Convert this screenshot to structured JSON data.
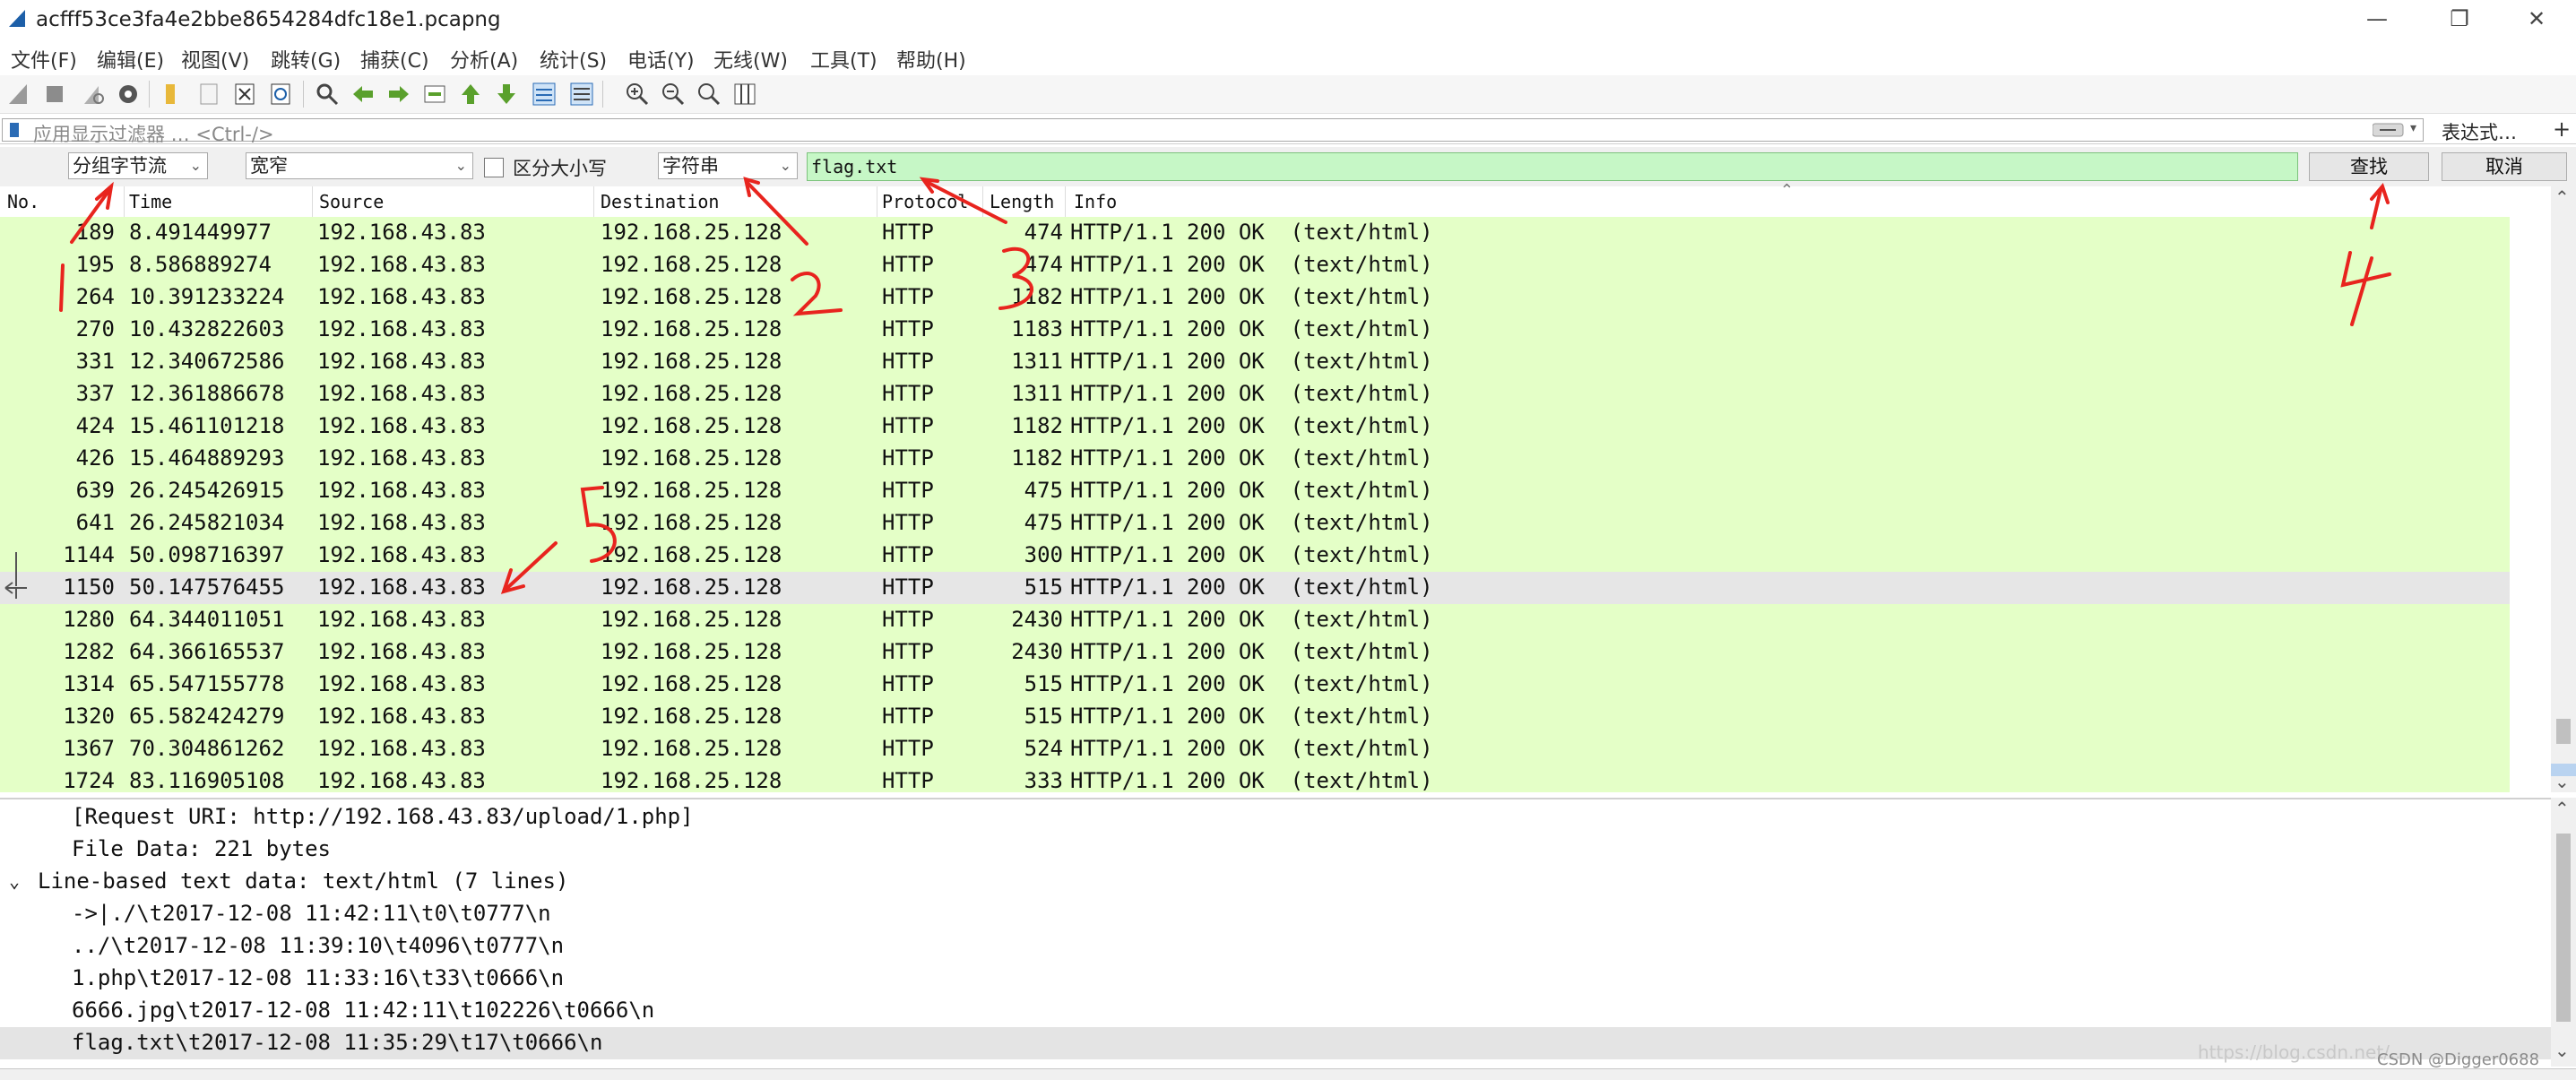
{
  "window": {
    "title": "acfff53ce3fa4e2bbe8654284dfc18e1.pcapng",
    "buttons": [
      "—",
      "❐",
      "✕"
    ]
  },
  "menu": [
    "文件(F)",
    "编辑(E)",
    "视图(V)",
    "跳转(G)",
    "捕获(C)",
    "分析(A)",
    "统计(S)",
    "电话(Y)",
    "无线(W)",
    "工具(T)",
    "帮助(H)"
  ],
  "filter": {
    "placeholder": "应用显示过滤器 … <Ctrl-/>",
    "expression_label": "表达式…",
    "plus": "+"
  },
  "find": {
    "search_in": "分组字节流",
    "char_width": "宽窄",
    "case_label": "区分大小写",
    "search_type": "字符串",
    "search_value": "flag.txt",
    "find_label": "查找",
    "cancel_label": "取消"
  },
  "columns": [
    "No.",
    "Time",
    "Source",
    "Destination",
    "Protocol",
    "Length",
    "Info"
  ],
  "packets": [
    {
      "no": "189",
      "time": "8.491449977",
      "src": "192.168.43.83",
      "dst": "192.168.25.128",
      "proto": "HTTP",
      "len": "474",
      "info": "HTTP/1.1 200 OK  (text/html)"
    },
    {
      "no": "195",
      "time": "8.586889274",
      "src": "192.168.43.83",
      "dst": "192.168.25.128",
      "proto": "HTTP",
      "len": "474",
      "info": "HTTP/1.1 200 OK  (text/html)"
    },
    {
      "no": "264",
      "time": "10.391233224",
      "src": "192.168.43.83",
      "dst": "192.168.25.128",
      "proto": "HTTP",
      "len": "1182",
      "info": "HTTP/1.1 200 OK  (text/html)"
    },
    {
      "no": "270",
      "time": "10.432822603",
      "src": "192.168.43.83",
      "dst": "192.168.25.128",
      "proto": "HTTP",
      "len": "1183",
      "info": "HTTP/1.1 200 OK  (text/html)"
    },
    {
      "no": "331",
      "time": "12.340672586",
      "src": "192.168.43.83",
      "dst": "192.168.25.128",
      "proto": "HTTP",
      "len": "1311",
      "info": "HTTP/1.1 200 OK  (text/html)"
    },
    {
      "no": "337",
      "time": "12.361886678",
      "src": "192.168.43.83",
      "dst": "192.168.25.128",
      "proto": "HTTP",
      "len": "1311",
      "info": "HTTP/1.1 200 OK  (text/html)"
    },
    {
      "no": "424",
      "time": "15.461101218",
      "src": "192.168.43.83",
      "dst": "192.168.25.128",
      "proto": "HTTP",
      "len": "1182",
      "info": "HTTP/1.1 200 OK  (text/html)"
    },
    {
      "no": "426",
      "time": "15.464889293",
      "src": "192.168.43.83",
      "dst": "192.168.25.128",
      "proto": "HTTP",
      "len": "1182",
      "info": "HTTP/1.1 200 OK  (text/html)"
    },
    {
      "no": "639",
      "time": "26.245426915",
      "src": "192.168.43.83",
      "dst": "192.168.25.128",
      "proto": "HTTP",
      "len": "475",
      "info": "HTTP/1.1 200 OK  (text/html)"
    },
    {
      "no": "641",
      "time": "26.245821034",
      "src": "192.168.43.83",
      "dst": "192.168.25.128",
      "proto": "HTTP",
      "len": "475",
      "info": "HTTP/1.1 200 OK  (text/html)"
    },
    {
      "no": "1144",
      "time": "50.098716397",
      "src": "192.168.43.83",
      "dst": "192.168.25.128",
      "proto": "HTTP",
      "len": "300",
      "info": "HTTP/1.1 200 OK  (text/html)"
    },
    {
      "no": "1150",
      "time": "50.147576455",
      "src": "192.168.43.83",
      "dst": "192.168.25.128",
      "proto": "HTTP",
      "len": "515",
      "info": "HTTP/1.1 200 OK  (text/html)"
    },
    {
      "no": "1280",
      "time": "64.344011051",
      "src": "192.168.43.83",
      "dst": "192.168.25.128",
      "proto": "HTTP",
      "len": "2430",
      "info": "HTTP/1.1 200 OK  (text/html)"
    },
    {
      "no": "1282",
      "time": "64.366165537",
      "src": "192.168.43.83",
      "dst": "192.168.25.128",
      "proto": "HTTP",
      "len": "2430",
      "info": "HTTP/1.1 200 OK  (text/html)"
    },
    {
      "no": "1314",
      "time": "65.547155778",
      "src": "192.168.43.83",
      "dst": "192.168.25.128",
      "proto": "HTTP",
      "len": "515",
      "info": "HTTP/1.1 200 OK  (text/html)"
    },
    {
      "no": "1320",
      "time": "65.582424279",
      "src": "192.168.43.83",
      "dst": "192.168.25.128",
      "proto": "HTTP",
      "len": "515",
      "info": "HTTP/1.1 200 OK  (text/html)"
    },
    {
      "no": "1367",
      "time": "70.304861262",
      "src": "192.168.43.83",
      "dst": "192.168.25.128",
      "proto": "HTTP",
      "len": "524",
      "info": "HTTP/1.1 200 OK  (text/html)"
    },
    {
      "no": "1724",
      "time": "83.116905108",
      "src": "192.168.43.83",
      "dst": "192.168.25.128",
      "proto": "HTTP",
      "len": "333",
      "info": "HTTP/1.1 200 OK  (text/html)"
    }
  ],
  "selected_packet": "1150",
  "details": [
    "[Request URI: http://192.168.43.83/upload/1.php]",
    "File Data: 221 bytes",
    "Line-based text data: text/html (7 lines)",
    "->|./\\t2017-12-08 11:42:11\\t0\\t0777\\n",
    "../\\t2017-12-08 11:39:10\\t4096\\t0777\\n",
    "1.php\\t2017-12-08 11:33:16\\t33\\t0666\\n",
    "6666.jpg\\t2017-12-08 11:42:11\\t102226\\t0666\\n",
    "flag.txt\\t2017-12-08 11:35:29\\t17\\t0666\\n"
  ],
  "annotations": [
    "1",
    "2",
    "3",
    "4",
    "5"
  ],
  "watermark": "https://blog.csdn.net/...",
  "watermark_credit": "CSDN @Digger0688",
  "colors": {
    "row_bg": "#e4ffc7",
    "selected_row_bg": "#e6e6e6",
    "search_field_bg": "#c6f7c6",
    "annotation_red": "#e8241e"
  },
  "icons": [
    "shark-fin-start-icon",
    "stop-icon",
    "restart-icon",
    "options-gear-icon",
    "open-folder-icon",
    "save-file-icon",
    "close-file-icon",
    "reload-icon",
    "find-packet-icon",
    "go-back-icon",
    "go-forward-icon",
    "go-to-packet-icon",
    "go-first-icon",
    "go-last-icon",
    "autoscroll-icon",
    "colorize-icon",
    "zoom-in-icon",
    "zoom-out-icon",
    "zoom-normal-icon",
    "resize-columns-icon"
  ]
}
